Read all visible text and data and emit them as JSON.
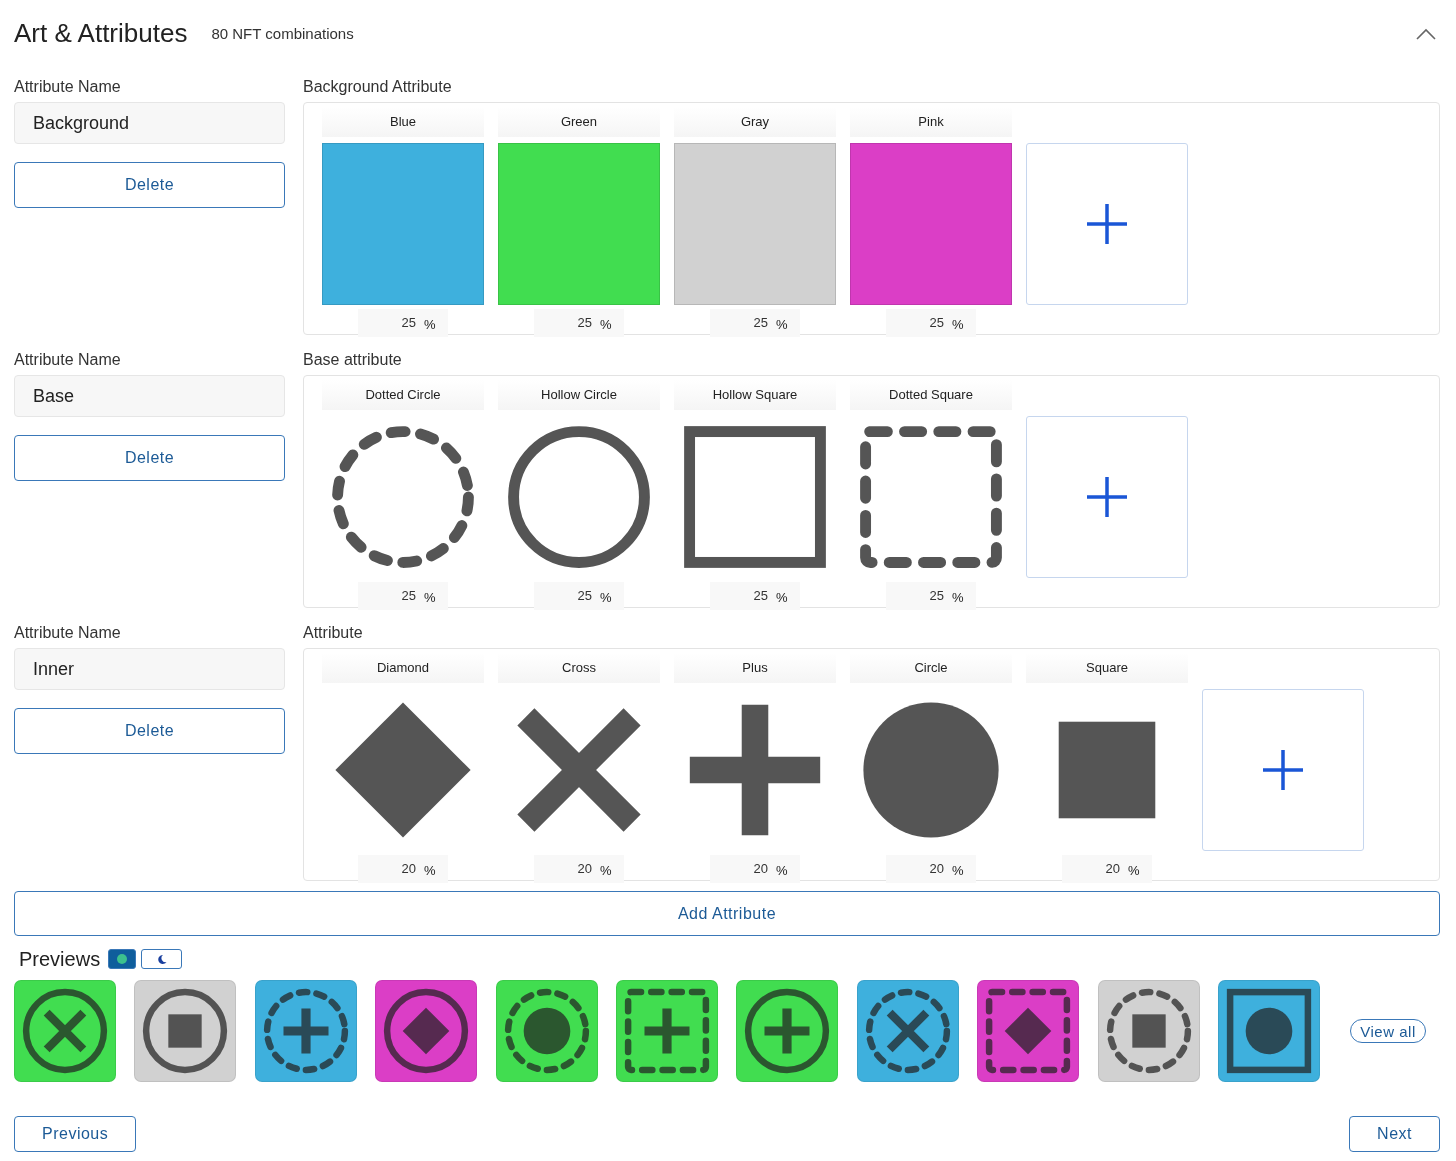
{
  "header": {
    "title": "Art & Attributes",
    "subtitle": "80 NFT combinations"
  },
  "attributes": [
    {
      "name_label": "Attribute Name",
      "name": "Background",
      "delete": "Delete",
      "section_label": "Background Attribute",
      "options": [
        {
          "kind": "color",
          "label": "Blue",
          "color": "#3eb0dd",
          "percent": "25",
          "unit": "%"
        },
        {
          "kind": "color",
          "label": "Green",
          "color": "#41dd50",
          "percent": "25",
          "unit": "%"
        },
        {
          "kind": "color",
          "label": "Gray",
          "color": "#d1d1d1",
          "percent": "25",
          "unit": "%"
        },
        {
          "kind": "color",
          "label": "Pink",
          "color": "#db3ec6",
          "percent": "25",
          "unit": "%"
        }
      ]
    },
    {
      "name_label": "Attribute Name",
      "name": "Base",
      "delete": "Delete",
      "section_label": "Base attribute",
      "options": [
        {
          "kind": "dotted-circle",
          "label": "Dotted Circle",
          "percent": "25",
          "unit": "%"
        },
        {
          "kind": "hollow-circle",
          "label": "Hollow Circle",
          "percent": "25",
          "unit": "%"
        },
        {
          "kind": "hollow-square",
          "label": "Hollow Square",
          "percent": "25",
          "unit": "%"
        },
        {
          "kind": "dotted-square",
          "label": "Dotted Square",
          "percent": "25",
          "unit": "%"
        }
      ]
    },
    {
      "name_label": "Attribute Name",
      "name": "Inner",
      "delete": "Delete",
      "section_label": "Attribute",
      "options": [
        {
          "kind": "diamond",
          "label": "Diamond",
          "percent": "20",
          "unit": "%"
        },
        {
          "kind": "cross",
          "label": "Cross",
          "percent": "20",
          "unit": "%"
        },
        {
          "kind": "plus",
          "label": "Plus",
          "percent": "20",
          "unit": "%"
        },
        {
          "kind": "circle",
          "label": "Circle",
          "percent": "20",
          "unit": "%"
        },
        {
          "kind": "square",
          "label": "Square",
          "percent": "20",
          "unit": "%"
        }
      ]
    }
  ],
  "add_attribute": "Add Attribute",
  "previews": {
    "title": "Previews",
    "toggle": [
      {
        "kind": "light",
        "selected": true
      },
      {
        "kind": "dark",
        "selected": false
      }
    ],
    "items": [
      {
        "color": "#41dd50",
        "layers": [
          {
            "kind": "hollow-circle"
          },
          {
            "kind": "cross"
          }
        ]
      },
      {
        "color": "#d1d1d1",
        "layers": [
          {
            "kind": "hollow-circle"
          },
          {
            "kind": "square"
          }
        ]
      },
      {
        "color": "#3eb0dd",
        "layers": [
          {
            "kind": "dotted-circle"
          },
          {
            "kind": "plus"
          }
        ]
      },
      {
        "color": "#db3ec6",
        "layers": [
          {
            "kind": "hollow-circle"
          },
          {
            "kind": "diamond"
          }
        ]
      },
      {
        "color": "#41dd50",
        "layers": [
          {
            "kind": "dotted-circle"
          },
          {
            "kind": "circle"
          }
        ]
      },
      {
        "color": "#41dd50",
        "layers": [
          {
            "kind": "dotted-square"
          },
          {
            "kind": "plus"
          }
        ]
      },
      {
        "color": "#41dd50",
        "layers": [
          {
            "kind": "hollow-circle"
          },
          {
            "kind": "plus"
          }
        ]
      },
      {
        "color": "#3eb0dd",
        "layers": [
          {
            "kind": "dotted-circle"
          },
          {
            "kind": "cross"
          }
        ]
      },
      {
        "color": "#db3ec6",
        "layers": [
          {
            "kind": "dotted-square"
          },
          {
            "kind": "diamond"
          }
        ]
      },
      {
        "color": "#d1d1d1",
        "layers": [
          {
            "kind": "dotted-circle"
          },
          {
            "kind": "square"
          }
        ]
      },
      {
        "color": "#3eb0dd",
        "layers": [
          {
            "kind": "hollow-square"
          },
          {
            "kind": "circle"
          }
        ]
      }
    ],
    "view_all": "View all"
  },
  "footer": {
    "previous": "Previous",
    "next": "Next"
  }
}
